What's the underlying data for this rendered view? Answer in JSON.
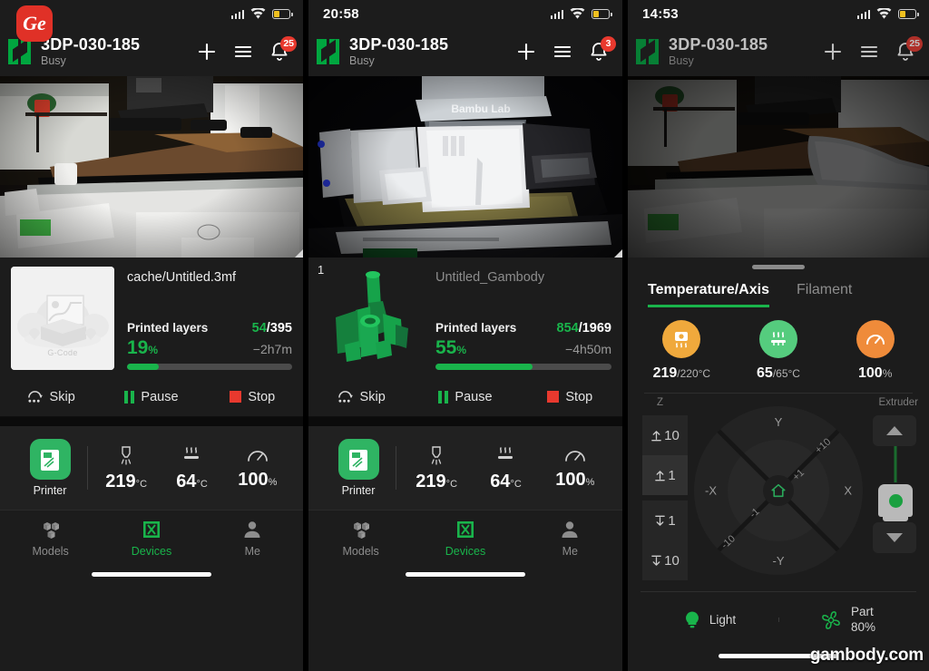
{
  "colors": {
    "green": "#19b44b",
    "red": "#e8392e",
    "orange": "#f0a93c",
    "orange_dark": "#ef8b3a",
    "panel_bg": "#1c1c1c"
  },
  "watermark": "gambody.com",
  "panels": [
    {
      "id": "panel-1",
      "statusbar": {
        "clock": "",
        "app_badge": "Ge"
      },
      "header": {
        "device_name": "3DP-030-185",
        "device_state": "Busy",
        "notification_count": "25"
      },
      "job": {
        "thumbnail_label": "G-Code",
        "file_name": "cache/Untitled.3mf",
        "layers_label": "Printed layers",
        "layers_current": "54",
        "layers_total": "/395",
        "percent": "19",
        "percent_sign": "%",
        "eta": "−2h7m",
        "progress": 19
      },
      "actions": {
        "skip": "Skip",
        "pause": "Pause",
        "stop": "Stop"
      },
      "stats": {
        "printer_label": "Printer",
        "cells": [
          {
            "icon": "nozzle-icon",
            "value": "219",
            "unit": "°C"
          },
          {
            "icon": "bed-heat-icon",
            "value": "64",
            "unit": "°C"
          },
          {
            "icon": "speed-gauge-icon",
            "value": "100",
            "unit": "%"
          }
        ]
      },
      "tabs": [
        {
          "label": "Models",
          "icon": "models-icon",
          "active": false
        },
        {
          "label": "Devices",
          "icon": "devices-icon",
          "active": true
        },
        {
          "label": "Me",
          "icon": "person-icon",
          "active": false
        }
      ]
    },
    {
      "id": "panel-2",
      "statusbar": {
        "clock": "20:58",
        "app_badge": ""
      },
      "header": {
        "device_name": "3DP-030-185",
        "device_state": "Busy",
        "notification_count": "3"
      },
      "job": {
        "sequence": "1",
        "thumbnail_label": "",
        "file_name": "Untitled_Gambody",
        "layers_label": "Printed layers",
        "layers_current": "854",
        "layers_total": "/1969",
        "percent": "55",
        "percent_sign": "%",
        "eta": "−4h50m",
        "progress": 55
      },
      "actions": {
        "skip": "Skip",
        "pause": "Pause",
        "stop": "Stop"
      },
      "stats": {
        "printer_label": "Printer",
        "cells": [
          {
            "icon": "nozzle-icon",
            "value": "219",
            "unit": "°C"
          },
          {
            "icon": "bed-heat-icon",
            "value": "64",
            "unit": "°C"
          },
          {
            "icon": "speed-gauge-icon",
            "value": "100",
            "unit": "%"
          }
        ]
      },
      "tabs": [
        {
          "label": "Models",
          "icon": "models-icon",
          "active": false
        },
        {
          "label": "Devices",
          "icon": "devices-icon",
          "active": true
        },
        {
          "label": "Me",
          "icon": "person-icon",
          "active": false
        }
      ]
    },
    {
      "id": "panel-3",
      "statusbar": {
        "clock": "14:53",
        "app_badge": ""
      },
      "header": {
        "device_name": "3DP-030-185",
        "device_state": "Busy",
        "notification_count": "25"
      },
      "control": {
        "tabs": [
          {
            "label": "Temperature/Axis",
            "active": true
          },
          {
            "label": "Filament",
            "active": false
          }
        ],
        "dials": [
          {
            "icon": "nozzle-temp-icon",
            "color": "#f0a93c",
            "current": "219",
            "target": "/220°C"
          },
          {
            "icon": "bed-temp-icon",
            "color": "#55cc7e",
            "current": "65",
            "target": "/65°C"
          },
          {
            "icon": "fan-speed-icon",
            "color": "#ef8b3a",
            "current": "100",
            "target": "%"
          }
        ],
        "axis": {
          "z_label": "Z",
          "extruder_label": "Extruder",
          "z_buttons": [
            {
              "label": "10",
              "icon": "arrow-up-line-icon",
              "selected": false
            },
            {
              "label": "1",
              "icon": "arrow-up-line-icon",
              "selected": true
            },
            {
              "label": "1",
              "icon": "arrow-down-line-icon",
              "selected": false
            },
            {
              "label": "10",
              "icon": "arrow-down-line-icon",
              "selected": false
            }
          ],
          "pad": {
            "y_plus": "Y",
            "y_minus": "-Y",
            "x_plus": "X",
            "x_minus": "-X",
            "step_plus_10": "+10",
            "step_plus_1": "+1",
            "step_minus_1": "-1",
            "step_minus_10": "-10",
            "home_icon": "home-icon"
          },
          "extruder_up_icon": "triangle-up-icon",
          "extruder_down_icon": "triangle-down-icon",
          "nozzle_icon": "extruder-nozzle-icon"
        },
        "bottom": {
          "light_label": "Light",
          "light_icon": "lightbulb-icon",
          "fan_label": "Part",
          "fan_value": "80%",
          "fan_icon": "fan-icon"
        }
      }
    }
  ]
}
